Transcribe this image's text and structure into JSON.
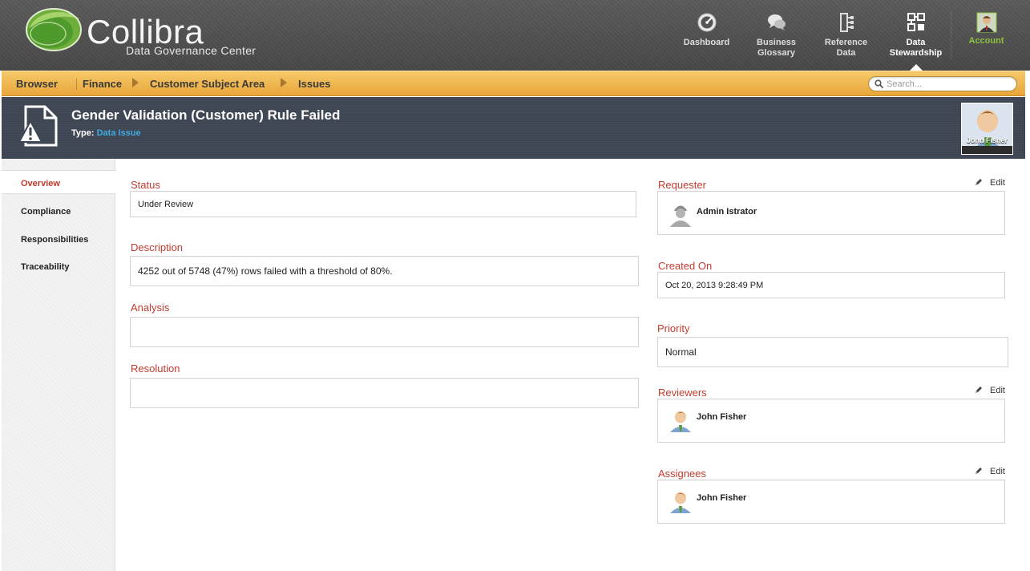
{
  "brand": {
    "name": "Collibra",
    "subtitle": "Data Governance Center",
    "colors": {
      "green": "#7ab648",
      "orange": "#eeb048",
      "header_dark": "#3e4654",
      "field_label": "#c23b2f",
      "link_blue": "#3fa9e0"
    }
  },
  "nav": {
    "items": [
      {
        "label": "Dashboard",
        "icon": "dashboard-gauge-icon"
      },
      {
        "label": "Business\nGlossary",
        "label_l1": "Business",
        "label_l2": "Glossary",
        "icon": "chat-bubbles-icon"
      },
      {
        "label_l1": "Reference",
        "label_l2": "Data",
        "icon": "reference-data-icon"
      },
      {
        "label_l1": "Data",
        "label_l2": "Stewardship",
        "icon": "data-stewardship-icon",
        "active": true
      },
      {
        "label": "Account",
        "icon": "account-avatar-icon"
      }
    ]
  },
  "breadcrumb": {
    "root": "Browser",
    "items": [
      "Finance",
      "Customer Subject Area",
      "Issues"
    ]
  },
  "search": {
    "placeholder": "Search..."
  },
  "asset": {
    "title": "Gender Validation (Customer) Rule Failed",
    "type_label": "Type:",
    "type_value": "Data Issue",
    "owner": "John Fisher"
  },
  "tabs": [
    "Overview",
    "Compliance",
    "Responsibilities",
    "Traceability"
  ],
  "active_tab": "Overview",
  "fields": {
    "status": {
      "label": "Status",
      "value": "Under Review"
    },
    "description": {
      "label": "Description",
      "value": "4252 out of 5748 (47%) rows failed with a threshold of 80%."
    },
    "analysis": {
      "label": "Analysis",
      "value": ""
    },
    "resolution": {
      "label": "Resolution",
      "value": ""
    },
    "requester": {
      "label": "Requester",
      "edit": "Edit",
      "user": "Admin Istrator"
    },
    "created_on": {
      "label": "Created On",
      "value": "Oct 20, 2013 9:28:49 PM"
    },
    "priority": {
      "label": "Priority",
      "value": "Normal"
    },
    "reviewers": {
      "label": "Reviewers",
      "edit": "Edit",
      "user": "John Fisher"
    },
    "assignees": {
      "label": "Assignees",
      "edit": "Edit",
      "user": "John Fisher"
    }
  }
}
